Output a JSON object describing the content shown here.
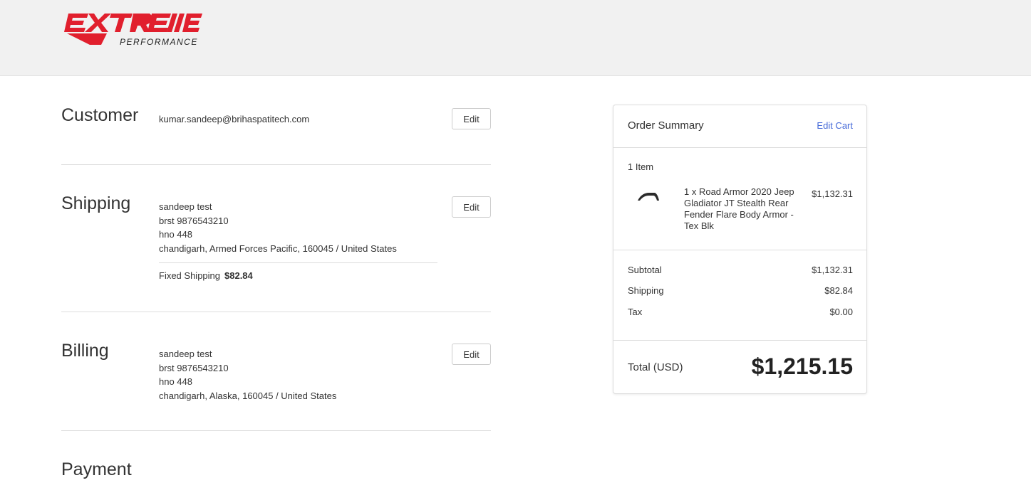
{
  "brand": {
    "logo_text": "EXTREME",
    "logo_subtext": "PERFORMANCE",
    "accent": "#e11f2d"
  },
  "customer": {
    "title": "Customer",
    "email": "kumar.sandeep@brihaspatitech.com",
    "edit_label": "Edit"
  },
  "shipping": {
    "title": "Shipping",
    "address": [
      "sandeep test",
      "brst 9876543210",
      "hno 448",
      "chandigarh, Armed Forces Pacific, 160045 / United States"
    ],
    "method_label": "Fixed Shipping",
    "method_price": "$82.84",
    "edit_label": "Edit"
  },
  "billing": {
    "title": "Billing",
    "address": [
      "sandeep test",
      "brst 9876543210",
      "hno 448",
      "chandigarh, Alaska, 160045 / United States"
    ],
    "edit_label": "Edit"
  },
  "payment": {
    "title": "Payment"
  },
  "summary": {
    "title": "Order Summary",
    "edit_cart_label": "Edit Cart",
    "item_count": "1 Item",
    "item": {
      "icon": "fender-flare-thumbnail",
      "name": "1 x Road Armor 2020 Jeep Gladiator JT Stealth Rear Fender Flare Body Armor - Tex Blk",
      "price": "$1,132.31"
    },
    "subtotal_label": "Subtotal",
    "subtotal": "$1,132.31",
    "shipping_label": "Shipping",
    "shipping": "$82.84",
    "tax_label": "Tax",
    "tax": "$0.00",
    "total_label": "Total (USD)",
    "total": "$1,215.15",
    "link_color": "#4469d8"
  }
}
